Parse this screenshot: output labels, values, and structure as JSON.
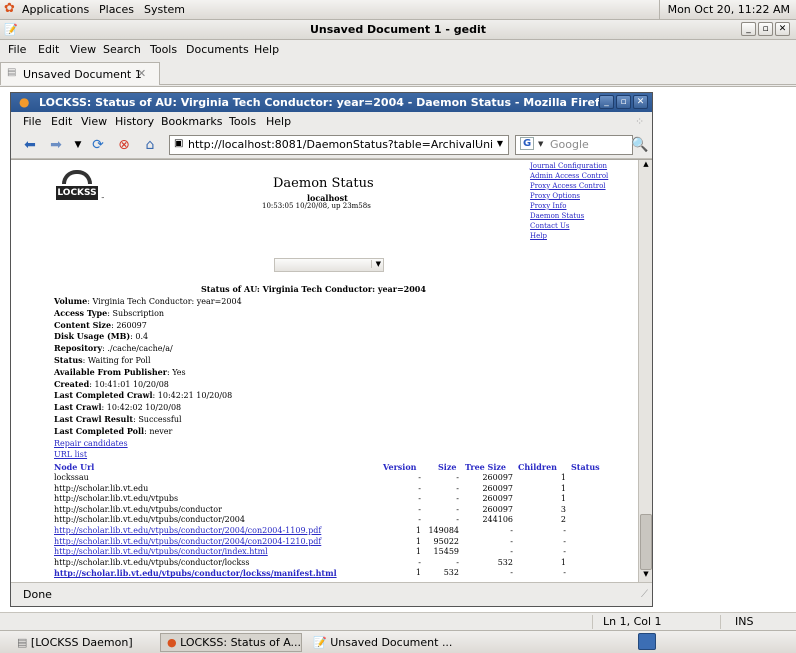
{
  "top_panel": {
    "menus": [
      "Applications",
      "Places",
      "System"
    ],
    "clock": "Mon Oct 20, 11:22 AM"
  },
  "gedit": {
    "title": "Unsaved Document 1 - gedit",
    "menu": [
      "File",
      "Edit",
      "View",
      "Search",
      "Tools",
      "Documents",
      "Help"
    ],
    "tab_label": "Unsaved Document 1",
    "status": {
      "position": "Ln 1, Col 1",
      "mode": "INS"
    }
  },
  "firefox": {
    "title": "LOCKSS: Status of AU: Virginia Tech Conductor: year=2004 - Daemon Status - Mozilla Firefox",
    "menu": [
      "File",
      "Edit",
      "View",
      "History",
      "Bookmarks",
      "Tools",
      "Help"
    ],
    "url": "http://localhost:8081/DaemonStatus?table=ArchivalUni",
    "search_placeholder": "Google",
    "status_text": "Done"
  },
  "page": {
    "logo_text": "LOCKSS",
    "heading": "Daemon Status",
    "host": "localhost",
    "timestamp": "10:53:05 10/20/08, up 23m58s",
    "nav_links": [
      "Journal Configuration",
      "Admin Access Control",
      "Proxy Access Control",
      "Proxy Options",
      "Proxy Info",
      "Daemon Status",
      "Contact Us",
      "Help"
    ],
    "au_title": "Status of AU: Virginia Tech Conductor: year=2004",
    "fields": [
      {
        "label": "Volume",
        "value": "Virginia Tech Conductor: year=2004"
      },
      {
        "label": "Access Type",
        "value": "Subscription"
      },
      {
        "label": "Content Size",
        "value": "260097"
      },
      {
        "label": "Disk Usage (MB)",
        "value": "0.4"
      },
      {
        "label": "Repository",
        "value": "./cache/cache/a/"
      },
      {
        "label": "Status",
        "value": "Waiting for Poll"
      },
      {
        "label": "Available From Publisher",
        "value": "Yes"
      },
      {
        "label": "Created",
        "value": "10:41:01 10/20/08"
      },
      {
        "label": "Last Completed Crawl",
        "value": "10:42:21 10/20/08"
      },
      {
        "label": "Last Crawl",
        "value": "10:42:02 10/20/08"
      },
      {
        "label": "Last Crawl Result",
        "value": "Successful"
      },
      {
        "label": "Last Completed Poll",
        "value": "never"
      }
    ],
    "links": [
      "Repair candidates",
      "URL list"
    ],
    "table": {
      "headers": [
        "Node Url",
        "Version",
        "Size",
        "Tree Size",
        "Children",
        "Status"
      ],
      "rows": [
        {
          "url": "lockssau",
          "version": "-",
          "size": "-",
          "tree": "260097",
          "children": "1",
          "link": false
        },
        {
          "url": "http://scholar.lib.vt.edu",
          "version": "-",
          "size": "-",
          "tree": "260097",
          "children": "1",
          "link": false
        },
        {
          "url": "http://scholar.lib.vt.edu/vtpubs",
          "version": "-",
          "size": "-",
          "tree": "260097",
          "children": "1",
          "link": false
        },
        {
          "url": "http://scholar.lib.vt.edu/vtpubs/conductor",
          "version": "-",
          "size": "-",
          "tree": "260097",
          "children": "3",
          "link": false
        },
        {
          "url": "http://scholar.lib.vt.edu/vtpubs/conductor/2004",
          "version": "-",
          "size": "-",
          "tree": "244106",
          "children": "2",
          "link": false
        },
        {
          "url": "http://scholar.lib.vt.edu/vtpubs/conductor/2004/con2004-1109.pdf",
          "version": "1",
          "size": "149084",
          "tree": "-",
          "children": "-",
          "link": true
        },
        {
          "url": "http://scholar.lib.vt.edu/vtpubs/conductor/2004/con2004-1210.pdf",
          "version": "1",
          "size": "95022",
          "tree": "-",
          "children": "-",
          "link": true
        },
        {
          "url": "http://scholar.lib.vt.edu/vtpubs/conductor/index.html",
          "version": "1",
          "size": "15459",
          "tree": "-",
          "children": "-",
          "link": true
        },
        {
          "url": "http://scholar.lib.vt.edu/vtpubs/conductor/lockss",
          "version": "-",
          "size": "-",
          "tree": "532",
          "children": "1",
          "link": false
        },
        {
          "url": "http://scholar.lib.vt.edu/vtpubs/conductor/lockss/manifest.html",
          "version": "1",
          "size": "532",
          "tree": "-",
          "children": "-",
          "link": true,
          "bold": true
        }
      ]
    }
  },
  "taskbar": {
    "items": [
      "[LOCKSS Daemon]",
      "LOCKSS: Status of A...",
      "Unsaved Document ..."
    ]
  }
}
